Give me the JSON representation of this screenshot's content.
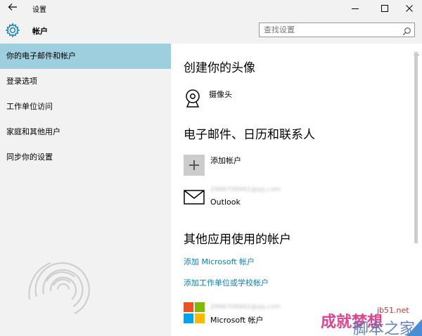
{
  "window": {
    "title": "设置"
  },
  "header": {
    "title": "帐户",
    "search_placeholder": "查找设置"
  },
  "sidebar": {
    "items": [
      {
        "label": "你的电子邮件和帐户",
        "selected": true
      },
      {
        "label": "登录选项"
      },
      {
        "label": "工作单位访问"
      },
      {
        "label": "家庭和其他用户"
      },
      {
        "label": "同步你的设置"
      }
    ]
  },
  "content": {
    "avatar_section": {
      "heading": "创建你的头像",
      "camera_label": "摄像头"
    },
    "email_section": {
      "heading": "电子邮件、日历和联系人",
      "add_account_label": "添加帐户",
      "account_email": "2966706842@qq.com",
      "account_provider": "Outlook"
    },
    "other_apps_section": {
      "heading": "其他应用使用的帐户",
      "add_microsoft_link": "添加 Microsoft 帐户",
      "add_work_link": "添加工作单位或学校帐户",
      "account_email": "2966706842@qq.com",
      "account_provider": "Microsoft 帐户"
    }
  },
  "watermark": {
    "chinese": "成就梦想",
    "site": "jb51.net",
    "text": "脚本之家"
  },
  "colors": {
    "accent": "#0a7fb5",
    "selected_bg": "#9ecfde",
    "sidebar_bg": "#f2f2f2"
  }
}
